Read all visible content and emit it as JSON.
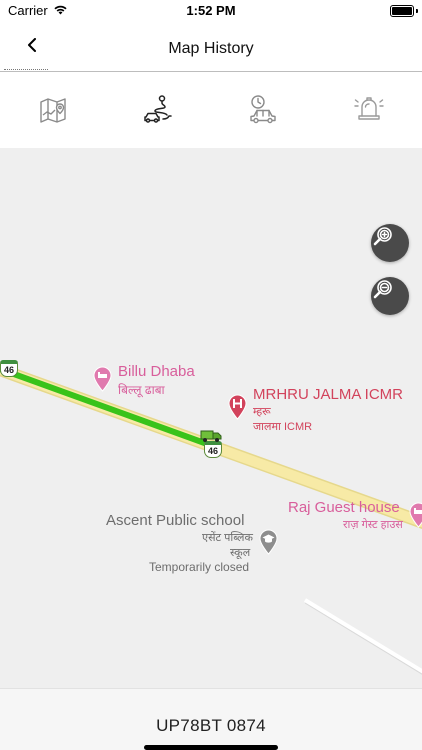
{
  "status_bar": {
    "carrier": "Carrier",
    "time": "1:52 PM"
  },
  "nav": {
    "title": "Map History",
    "back_icon": "chevron-left-icon"
  },
  "tabs": [
    {
      "icon": "map-icon",
      "active": false
    },
    {
      "icon": "route-car-icon",
      "active": true
    },
    {
      "icon": "clock-car-icon",
      "active": false
    },
    {
      "icon": "alarm-bell-icon",
      "active": false
    }
  ],
  "map": {
    "highway_shield": "46",
    "pois": {
      "billu_dhaba": {
        "name": "Billu Dhaba",
        "name_hi": "बिल्लू ढाबा"
      },
      "mrhru": {
        "name": "MRHRU JALMA ICMR",
        "line2": "म्हरू",
        "line3": "जालमा ICMR"
      },
      "raj_guest_house": {
        "name": "Raj Guest house",
        "name_hi": "राज़ गेस्ट हाउस"
      },
      "ascent_school": {
        "name": "Ascent Public school",
        "line2": "एसेंट पब्लिक",
        "line3": "स्कूल",
        "status": "Temporarily closed"
      }
    },
    "colors": {
      "route": "#39c31a",
      "road": "#f7eaa6",
      "pink_poi": "#d85e9b",
      "hospital": "#d2435c",
      "zoom_bg": "#4a4a4a"
    }
  },
  "zoom": {
    "in_icon": "zoom-in-icon",
    "out_icon": "zoom-out-icon"
  },
  "vehicle": {
    "number": "UP78BT 0874"
  }
}
